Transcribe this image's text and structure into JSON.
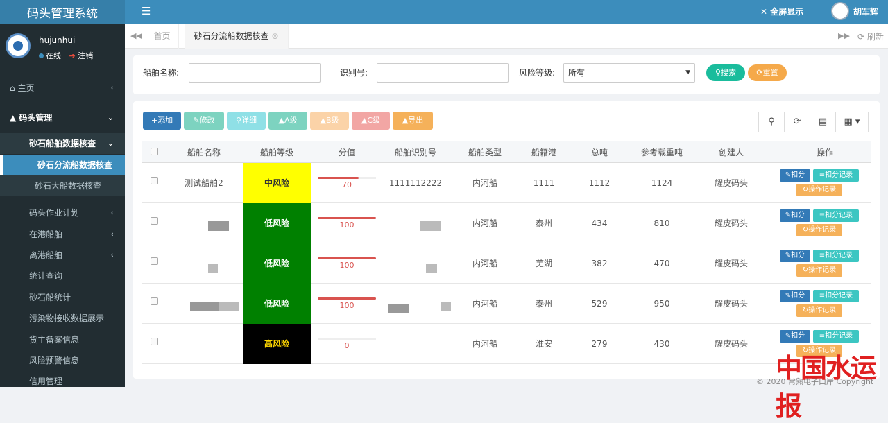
{
  "app": {
    "title": "码头管理系统",
    "menu_icon": "☰",
    "fullscreen": "全屏显示",
    "user_display": "胡军辉"
  },
  "sidebar": {
    "username": "hujunhui",
    "status": "在线",
    "logout": "注销",
    "home": "主页",
    "group": "码头管理",
    "sub_group": "砂石船舶数据核查",
    "active_item": "砂石分流船数据核查",
    "sub_item_2": "砂石大船数据核查",
    "items": [
      "码头作业计划",
      "在港船舶",
      "离港船舶",
      "统计查询",
      "砂石船统计",
      "污染物接收数据展示",
      "货主备案信息",
      "风险预警信息",
      "信用管理"
    ]
  },
  "tabs": {
    "home": "首页",
    "active": "砂石分流船数据核查",
    "refresh": "刷新"
  },
  "search": {
    "ship_name_label": "船舶名称:",
    "ship_name_value": "",
    "id_label": "识别号:",
    "id_value": "",
    "risk_label": "风险等级:",
    "risk_value": "所有",
    "search_btn": "搜索",
    "reset_btn": "重置"
  },
  "toolbar": {
    "add": "添加",
    "edit": "修改",
    "detail": "详细",
    "a": "A级",
    "b": "B级",
    "c": "C级",
    "export": "导出"
  },
  "table": {
    "headers": [
      "船舶名称",
      "船舶等级",
      "分值",
      "船舶识别号",
      "船舶类型",
      "船籍港",
      "总吨",
      "参考载重吨",
      "创建人",
      "操作"
    ],
    "rows": [
      {
        "name": "测试船舶2",
        "risk": "中风险",
        "score": "70",
        "score_pct": 70,
        "id": "1111112222",
        "type": "内河船",
        "port": "1111",
        "gt": "1112",
        "dwt": "1124",
        "creator": "耀皮码头"
      },
      {
        "name": "",
        "risk": "低风险",
        "score": "100",
        "score_pct": 100,
        "id": "",
        "type": "内河船",
        "port": "泰州",
        "gt": "434",
        "dwt": "810",
        "creator": "耀皮码头"
      },
      {
        "name": "",
        "risk": "低风险",
        "score": "100",
        "score_pct": 100,
        "id": "",
        "type": "内河船",
        "port": "芜湖",
        "gt": "382",
        "dwt": "470",
        "creator": "耀皮码头"
      },
      {
        "name": "",
        "risk": "低风险",
        "score": "100",
        "score_pct": 100,
        "id": "",
        "type": "内河船",
        "port": "泰州",
        "gt": "529",
        "dwt": "950",
        "creator": "耀皮码头"
      },
      {
        "name": "",
        "risk": "高风险",
        "score": "0",
        "score_pct": 0,
        "id": "",
        "type": "内河船",
        "port": "淮安",
        "gt": "279",
        "dwt": "430",
        "creator": "耀皮码头"
      }
    ],
    "actions": {
      "deduct": "扣分",
      "deduct_log": "扣分记录",
      "op_log": "操作记录"
    }
  },
  "footer": "© 2020 常熟电子口岸 Copyright",
  "watermark": "中国水运报",
  "colors": {
    "primary": "#3c8dbc",
    "risk_mid": "#ffff00",
    "risk_low": "#008000",
    "risk_high": "#000000"
  }
}
